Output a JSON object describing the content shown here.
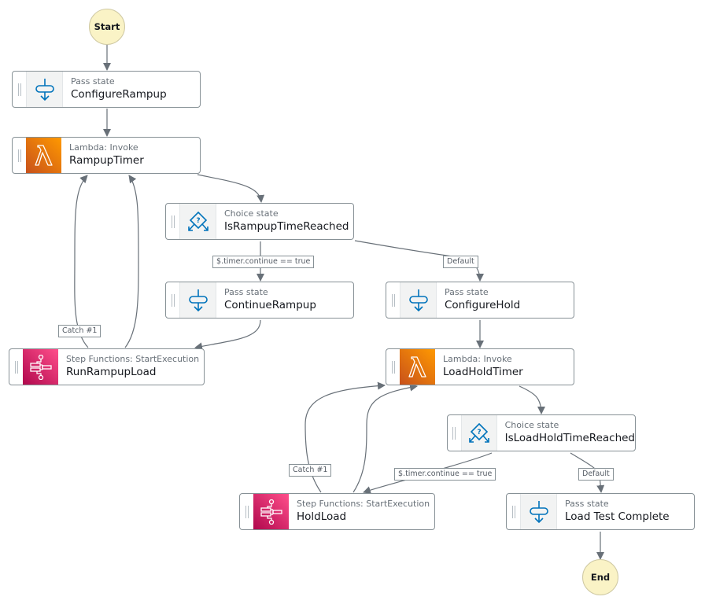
{
  "diagram": {
    "terminals": {
      "start": "Start",
      "end": "End"
    },
    "states": [
      {
        "id": "configure-rampup",
        "type": "Pass state",
        "name": "ConfigureRampup",
        "kind": "pass"
      },
      {
        "id": "rampup-timer",
        "type": "Lambda: Invoke",
        "name": "RampupTimer",
        "kind": "lambda"
      },
      {
        "id": "is-rampup-time-reached",
        "type": "Choice state",
        "name": "IsRampupTimeReached",
        "kind": "choice"
      },
      {
        "id": "continue-rampup",
        "type": "Pass state",
        "name": "ContinueRampup",
        "kind": "pass"
      },
      {
        "id": "configure-hold",
        "type": "Pass state",
        "name": "ConfigureHold",
        "kind": "pass"
      },
      {
        "id": "run-rampup-load",
        "type": "Step Functions: StartExecution",
        "name": "RunRampupLoad",
        "kind": "sfn"
      },
      {
        "id": "load-hold-timer",
        "type": "Lambda: Invoke",
        "name": "LoadHoldTimer",
        "kind": "lambda"
      },
      {
        "id": "is-load-hold-time-reached",
        "type": "Choice state",
        "name": "IsLoadHoldTimeReached",
        "kind": "choice"
      },
      {
        "id": "hold-load",
        "type": "Step Functions: StartExecution",
        "name": "HoldLoad",
        "kind": "sfn"
      },
      {
        "id": "load-test-complete",
        "type": "Pass state",
        "name": "Load Test Complete",
        "kind": "pass"
      }
    ],
    "edge_labels": {
      "rampup_continue": "$.timer.continue == true",
      "rampup_default": "Default",
      "rampup_catch": "Catch #1",
      "hold_continue": "$.timer.continue == true",
      "hold_default": "Default",
      "hold_catch": "Catch #1"
    },
    "colors": {
      "edge": "#687078",
      "pass_icon": "#0073bb",
      "lambda_from": "#c8511b",
      "lambda_to": "#ff9900",
      "sfn_from": "#b0084d",
      "sfn_to": "#ff4f8b",
      "terminal_fill": "#faf3c6"
    }
  }
}
